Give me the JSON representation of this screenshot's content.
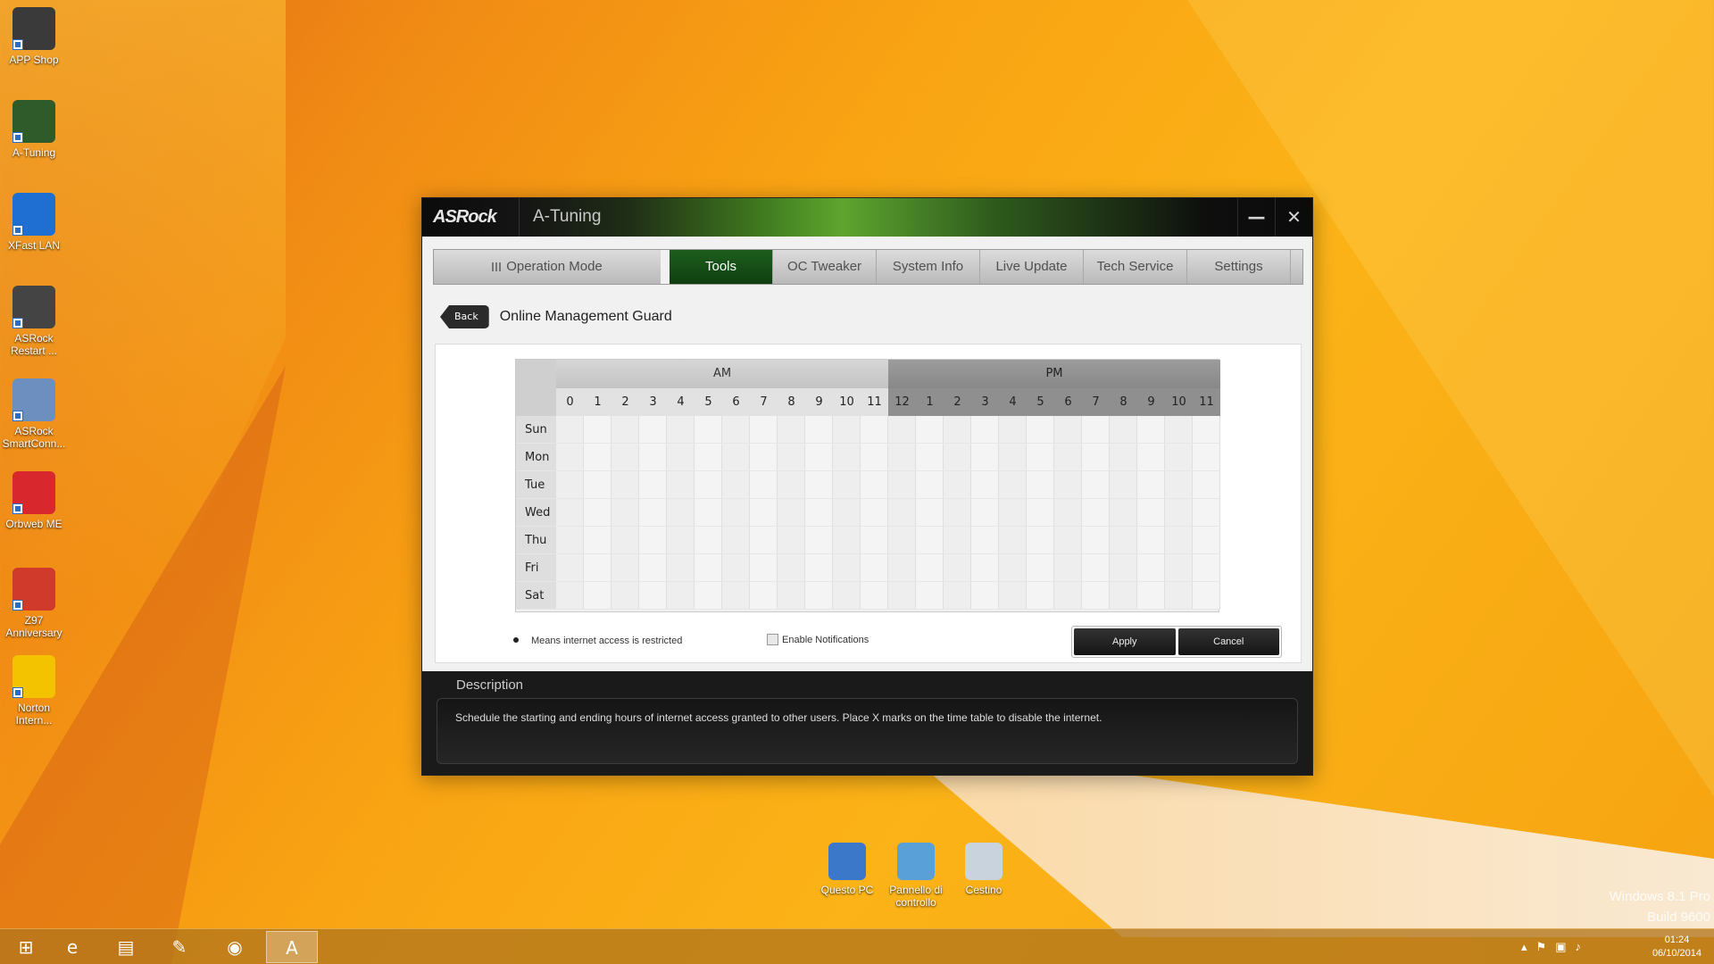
{
  "desktop": {
    "icons_left": [
      {
        "label": "APP Shop",
        "icon": "app-shop-icon",
        "color": "#3a3a3a"
      },
      {
        "label": "A-Tuning",
        "icon": "a-tuning-icon",
        "color": "#2f5a2a"
      },
      {
        "label": "XFast LAN",
        "icon": "xfast-lan-icon",
        "color": "#1e6fd1"
      },
      {
        "label": "ASRock Restart ...",
        "icon": "uefi-restart-icon",
        "color": "#444"
      },
      {
        "label": "ASRock SmartConn...",
        "icon": "smart-connect-icon",
        "color": "#6c8fbf"
      },
      {
        "label": "Orbweb ME",
        "icon": "orbweb-icon",
        "color": "#d8282e"
      },
      {
        "label": "Z97 Anniversary",
        "icon": "pdf-document-icon",
        "color": "#d03a2a"
      },
      {
        "label": "Norton Intern...",
        "icon": "norton-icon",
        "color": "#f3c300"
      }
    ],
    "icons_bottom": [
      {
        "label": "Questo PC",
        "icon": "this-pc-icon"
      },
      {
        "label": "Pannello di controllo",
        "icon": "control-panel-icon"
      },
      {
        "label": "Cestino",
        "icon": "recycle-bin-icon"
      }
    ],
    "watermark": {
      "line1": "Windows 8.1 Pro",
      "line2": "Build 9600"
    }
  },
  "window": {
    "brand": "ASRock",
    "title": "A-Tuning",
    "minimize": "—",
    "close": "✕"
  },
  "nav": {
    "operation_mode": "Operation Mode",
    "tabs": [
      "Tools",
      "OC Tweaker",
      "System Info",
      "Live Update",
      "Tech Service",
      "Settings"
    ],
    "active_tab": "Tools"
  },
  "page": {
    "back_label": "Back",
    "title": "Online Management Guard"
  },
  "schedule": {
    "am_label": "AM",
    "pm_label": "PM",
    "am_hours": [
      "0",
      "1",
      "2",
      "3",
      "4",
      "5",
      "6",
      "7",
      "8",
      "9",
      "10",
      "11"
    ],
    "pm_hours": [
      "12",
      "1",
      "2",
      "3",
      "4",
      "5",
      "6",
      "7",
      "8",
      "9",
      "10",
      "11"
    ],
    "days": [
      "Sun",
      "Mon",
      "Tue",
      "Wed",
      "Thu",
      "Fri",
      "Sat"
    ]
  },
  "legend": {
    "text": "Means internet access is restricted"
  },
  "notifications": {
    "label": "Enable Notifications",
    "checked": false
  },
  "actions": {
    "apply": "Apply",
    "cancel": "Cancel"
  },
  "description": {
    "title": "Description",
    "text": "Schedule the starting and ending hours of internet access granted to other users. Place X marks on the time table to disable the internet."
  },
  "taskbar": {
    "apps": [
      {
        "name": "start",
        "icon": "windows-start-icon"
      },
      {
        "name": "ie",
        "icon": "internet-explorer-icon"
      },
      {
        "name": "explorer",
        "icon": "file-explorer-icon"
      },
      {
        "name": "paint",
        "icon": "paint-icon"
      },
      {
        "name": "chrome",
        "icon": "chrome-icon"
      },
      {
        "name": "atuning",
        "icon": "a-tuning-taskbar-icon",
        "active": true
      }
    ],
    "time": "01:24",
    "date": "06/10/2014"
  }
}
